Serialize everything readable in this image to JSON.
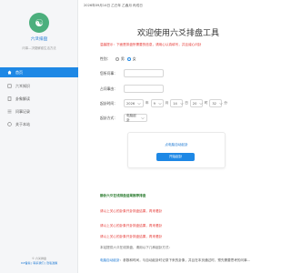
{
  "topbar": {
    "date_text": "2026年09月14日    乙已年 乙酉月 丙戌日"
  },
  "sidebar": {
    "brand": "六爻排盘",
    "slogan": "问事—决疑解惑生活方法",
    "items": [
      {
        "label": "首页",
        "icon": "home-icon",
        "active": true
      },
      {
        "label": "六爻知识",
        "icon": "book-icon",
        "active": false
      },
      {
        "label": "卦象解读",
        "icon": "document-icon",
        "active": false
      },
      {
        "label": "问事记录",
        "icon": "list-icon",
        "active": false
      },
      {
        "label": "关于本站",
        "icon": "info-icon",
        "active": false
      }
    ],
    "footer_copy": "© 六爻排盘",
    "footer_links": "ICP备案 | 联系我们 | 隐私政策"
  },
  "main": {
    "title": "欢迎使用六爻排盘工具",
    "notice": "温馨提示：下面是排盘所需要的信息，请用心认真填写，并且诚心问卦",
    "gender": {
      "label": "性别：",
      "options": [
        "男",
        "女"
      ],
      "selected": "女"
    },
    "question": {
      "label": "您所问事：",
      "placeholder": ""
    },
    "name": {
      "label": "占问事由：",
      "placeholder": ""
    },
    "time": {
      "label": "起卦时间：",
      "year": "2026",
      "year_unit": "年",
      "month": "9",
      "month_unit": "月",
      "day": "14",
      "day_unit": "日",
      "hour": "20",
      "hour_unit": "时",
      "minute": "32",
      "minute_unit": "分"
    },
    "method": {
      "label": "起卦方式：",
      "value": "电脑起卦"
    },
    "card": {
      "link": "点电脑自动起卦",
      "button": "开始起卦"
    },
    "result": {
      "title": "静卦六爻在线排盘结果推荐排盘",
      "lines": [
        "请以上关心的卦象开卦排盘结果，再来看卦",
        "请以上关心的卦象开卦排盘结果，再来看卦",
        "请以上关心的卦象开卦排盘结果，再来看卦",
        "本站提供六爻在线排盘，请用以下几种起卦方式："
      ],
      "desc_link": "电脑自动起卦",
      "desc_rest": "：参数和时间，与自动起卦时记录下来的卦象，并且在本页通过时，预先需要思考的问事..."
    }
  },
  "colors": {
    "accent": "#1e88e5",
    "notice": "#e53935",
    "result_title": "#2e7d32",
    "logo": "#4caf7d"
  }
}
